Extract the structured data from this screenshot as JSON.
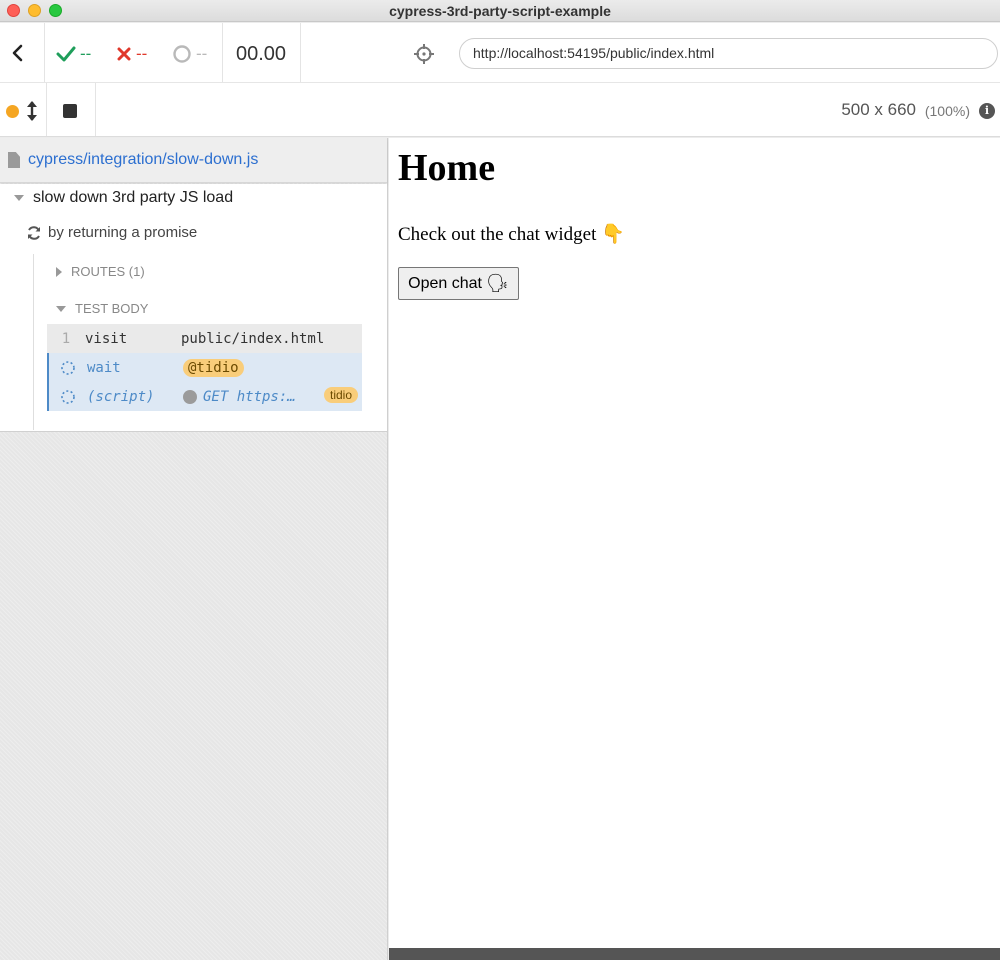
{
  "window": {
    "title": "cypress-3rd-party-script-example"
  },
  "toolbar": {
    "passed": "--",
    "failed": "--",
    "pending": "--",
    "duration": "00.00",
    "url": "http://localhost:54195/public/index.html",
    "viewport_size": "500 x 660",
    "viewport_scale": "(100%)",
    "info_glyph": "i"
  },
  "reporter": {
    "spec_path": "cypress/integration/slow-down.js",
    "suite_title": "slow down 3rd party JS load",
    "test_title": "by returning a promise",
    "routes_label": "ROUTES (1)",
    "test_body_label": "TEST BODY",
    "commands": [
      {
        "number": "1",
        "name": "visit",
        "message": "public/index.html"
      },
      {
        "name": "wait",
        "alias": "@tidio"
      },
      {
        "name": "(script)",
        "message": "GET https:…",
        "badge": "tidio"
      }
    ]
  },
  "app": {
    "heading": "Home",
    "lead_text": "Check out the chat widget",
    "lead_emoji": "👇",
    "button_label": "Open chat",
    "button_emoji": "🗣"
  }
}
